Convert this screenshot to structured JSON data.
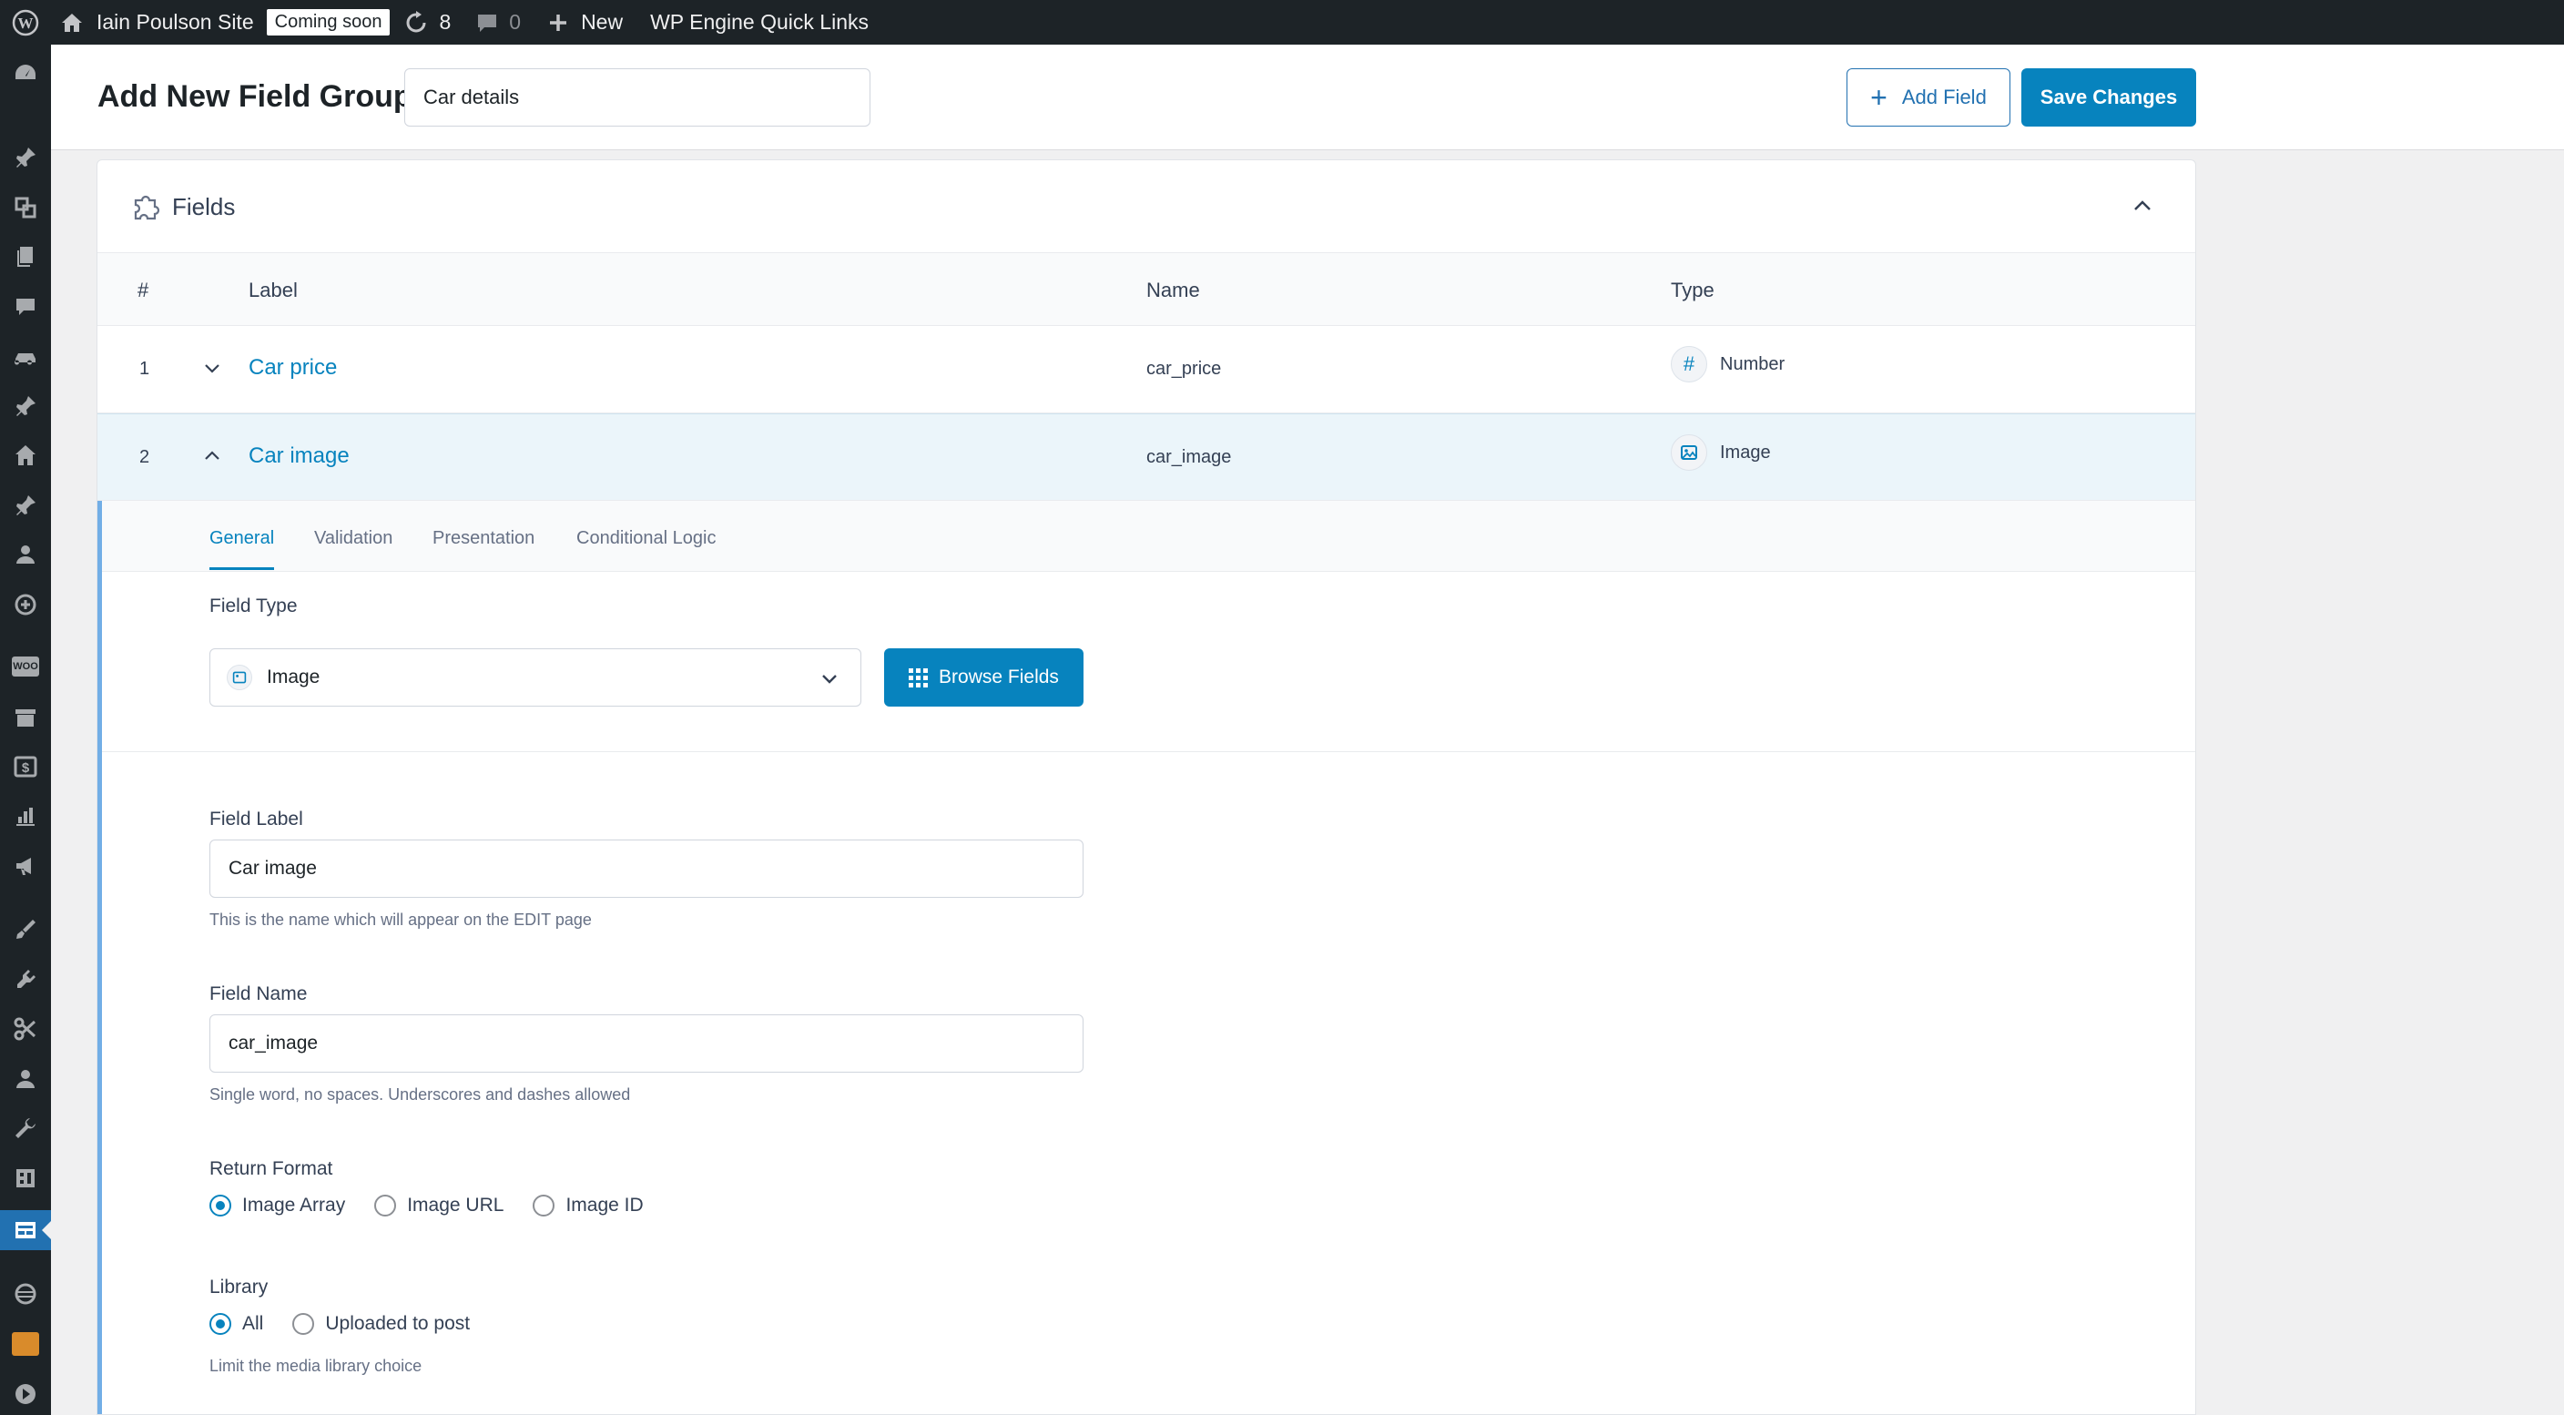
{
  "adminbar": {
    "site_name": "Iain Poulson Site",
    "coming_soon": "Coming soon",
    "updates_count": "8",
    "comments_count": "0",
    "new_label": "New",
    "quick_links": "WP Engine Quick Links"
  },
  "header": {
    "page_title": "Add New Field Group",
    "group_title_value": "Car details",
    "add_field_label": "Add Field",
    "save_label": "Save Changes"
  },
  "panel": {
    "title": "Fields",
    "columns": {
      "num": "#",
      "label": "Label",
      "name": "Name",
      "type": "Type"
    },
    "rows": [
      {
        "num": "1",
        "label": "Car price",
        "name": "car_price",
        "type": "Number",
        "type_icon": "hash-icon"
      },
      {
        "num": "2",
        "label": "Car image",
        "name": "car_image",
        "type": "Image",
        "type_icon": "image-icon"
      }
    ]
  },
  "settings": {
    "tabs": [
      "General",
      "Validation",
      "Presentation",
      "Conditional Logic"
    ],
    "field_type_label": "Field Type",
    "field_type_value": "Image",
    "browse_fields_label": "Browse Fields",
    "field_label_label": "Field Label",
    "field_label_value": "Car image",
    "field_label_help": "This is the name which will appear on the EDIT page",
    "field_name_label": "Field Name",
    "field_name_value": "car_image",
    "field_name_help": "Single word, no spaces. Underscores and dashes allowed",
    "return_format_label": "Return Format",
    "return_format_options": [
      "Image Array",
      "Image URL",
      "Image ID"
    ],
    "return_format_selected": "Image Array",
    "library_label": "Library",
    "library_options": [
      "All",
      "Uploaded to post"
    ],
    "library_selected": "All",
    "library_help": "Limit the media library choice"
  },
  "colors": {
    "accent": "#0783be",
    "admin_bar": "#1d2327",
    "selected_row": "#ebf5fa",
    "expanded_border": "#72aee6"
  }
}
